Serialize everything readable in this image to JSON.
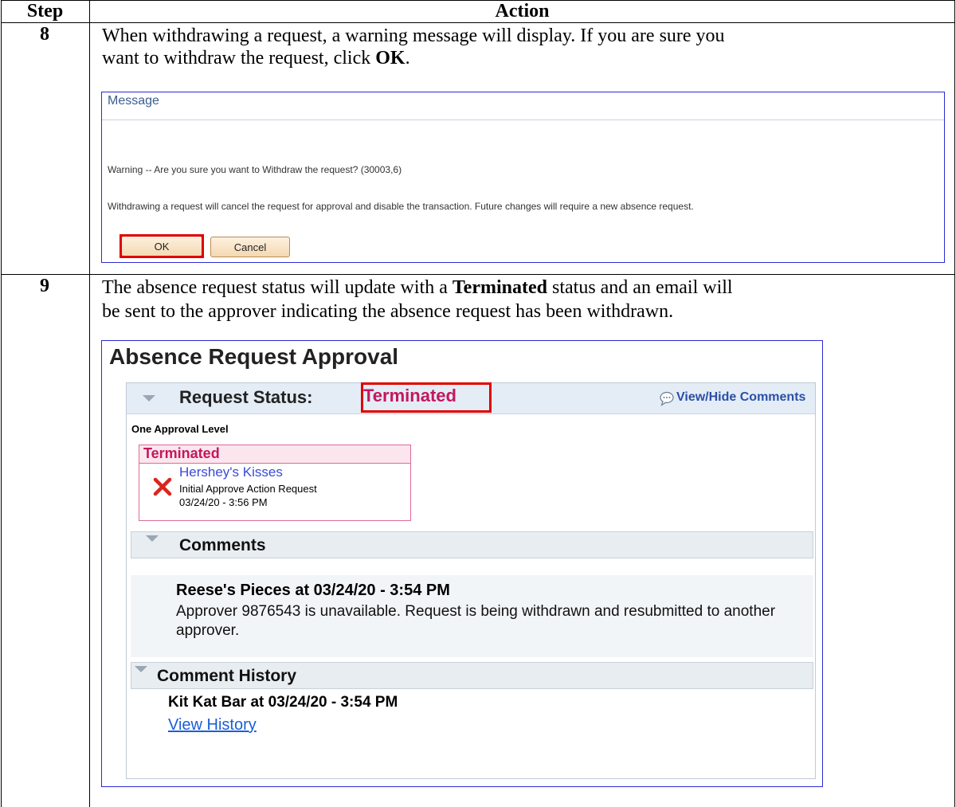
{
  "table": {
    "header_step": "Step",
    "header_action": "Action",
    "rows": [
      {
        "step": "8",
        "text_line1": "When withdrawing a request, a warning message will display.  If you are sure you",
        "text_line2_before": "want to withdraw the request, click ",
        "text_line2_bold": "OK",
        "text_line2_after": "."
      },
      {
        "step": "9",
        "text_line1_before": "The absence request status will update with a ",
        "text_line1_bold": "Terminated",
        "text_line1_after": " status and an email will",
        "text_line2": "be sent to the approver indicating the absence request has been withdrawn."
      }
    ]
  },
  "message_dialog": {
    "title": "Message",
    "warning": "Warning -- Are you sure you want to Withdraw the request? (30003,6)",
    "detail": "Withdrawing a request will cancel the request for approval and disable the transaction.  Future changes will require a new absence request.",
    "ok_label": "OK",
    "cancel_label": "Cancel"
  },
  "approval": {
    "title": "Absence Request Approval",
    "status_label": "Request Status:",
    "status_value": "Terminated",
    "view_hide_label": "View/Hide Comments",
    "level_label": "One Approval Level",
    "card": {
      "header": "Terminated",
      "approver": "Hershey's Kisses",
      "action": "Initial Approve Action Request",
      "datetime": "03/24/20 - 3:56 PM"
    },
    "comments_label": "Comments",
    "comment_author": "Reese's Pieces at 03/24/20 - 3:54 PM",
    "comment_text": "Approver 9876543 is unavailable.  Request is being withdrawn and resubmitted to another approver.",
    "history_label": "Comment History",
    "history_author": "Kit Kat Bar at 03/24/20 - 3:54 PM",
    "history_link": "View History"
  },
  "colors": {
    "terminated": "#c5175b",
    "highlight": "#e00000",
    "link": "#1a5ed6",
    "frame": "#2b2bd6"
  }
}
